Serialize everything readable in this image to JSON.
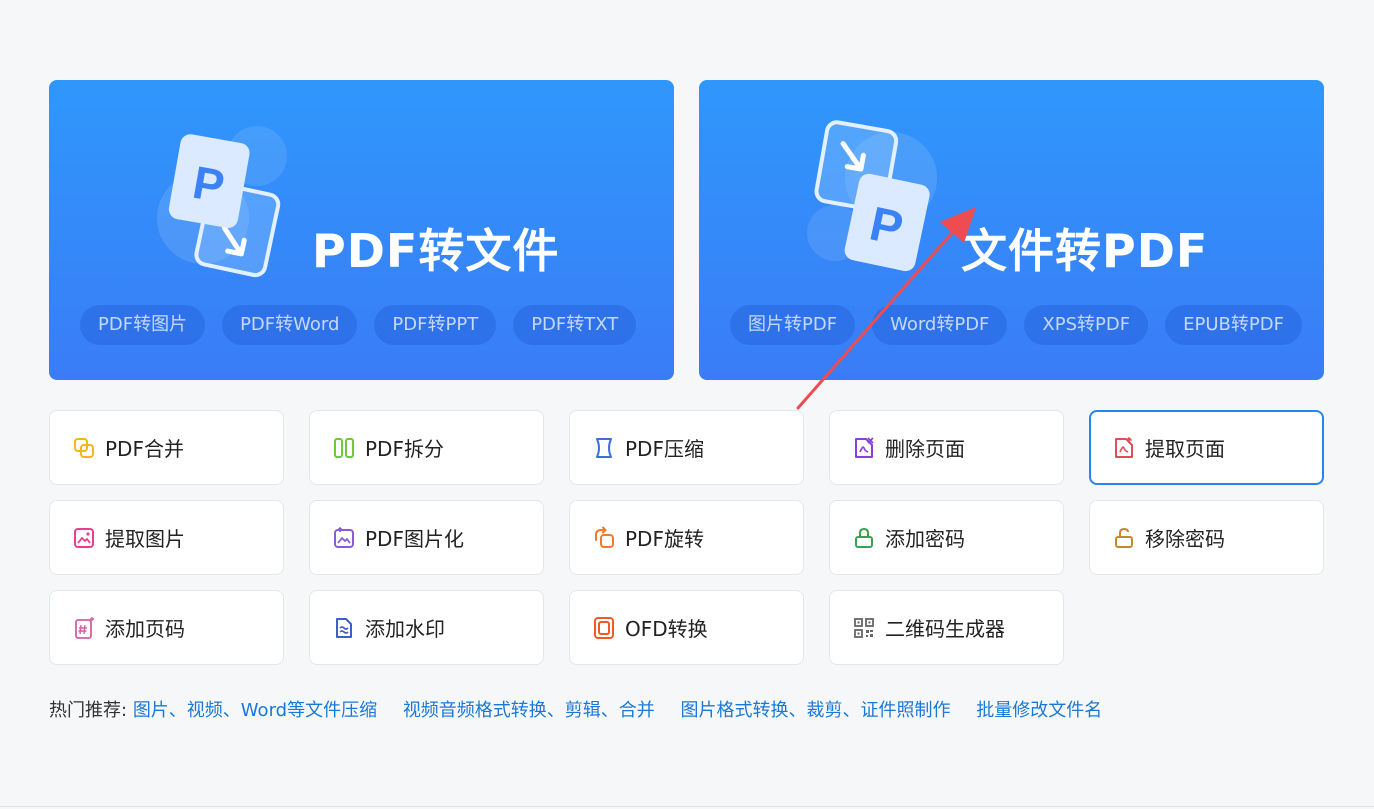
{
  "hero_left": {
    "title": "PDF转文件",
    "chips": [
      "PDF转图片",
      "PDF转Word",
      "PDF转PPT",
      "PDF转TXT"
    ]
  },
  "hero_right": {
    "title": "文件转PDF",
    "chips": [
      "图片转PDF",
      "Word转PDF",
      "XPS转PDF",
      "EPUB转PDF"
    ]
  },
  "tools": [
    {
      "label": "PDF合并",
      "icon": "merge-icon"
    },
    {
      "label": "PDF拆分",
      "icon": "split-icon"
    },
    {
      "label": "PDF压缩",
      "icon": "compress-icon"
    },
    {
      "label": "删除页面",
      "icon": "delete-page-icon"
    },
    {
      "label": "提取页面",
      "icon": "extract-page-icon",
      "selected": true
    },
    {
      "label": "提取图片",
      "icon": "extract-image-icon"
    },
    {
      "label": "PDF图片化",
      "icon": "pdf-to-image-icon"
    },
    {
      "label": "PDF旋转",
      "icon": "rotate-icon"
    },
    {
      "label": "添加密码",
      "icon": "lock-icon"
    },
    {
      "label": "移除密码",
      "icon": "unlock-icon"
    },
    {
      "label": "添加页码",
      "icon": "page-number-icon"
    },
    {
      "label": "添加水印",
      "icon": "watermark-icon"
    },
    {
      "label": "OFD转换",
      "icon": "ofd-icon"
    },
    {
      "label": "二维码生成器",
      "icon": "qrcode-icon"
    }
  ],
  "hot": {
    "label": "热门推荐:",
    "links": [
      "图片、视频、Word等文件压缩",
      "视频音频格式转换、剪辑、合并",
      "图片格式转换、裁剪、证件照制作",
      "批量修改文件名"
    ]
  },
  "colors": {
    "hero_top": "#2f97fc",
    "hero_bottom": "#3a7cf6",
    "link": "#1a79d8",
    "active_border": "#2a84ee",
    "annotation_arrow": "#ee4c50"
  }
}
